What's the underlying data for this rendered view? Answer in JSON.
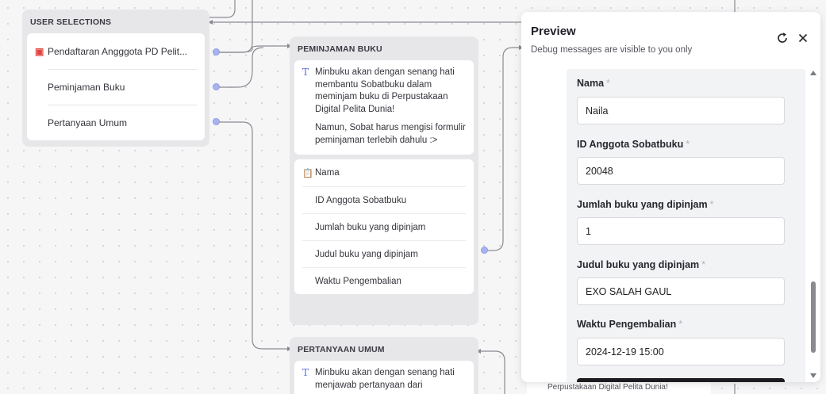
{
  "user_selections": {
    "header": "USER SELECTIONS",
    "items": [
      {
        "label": "Pendaftaran Angggota PD Pelit...",
        "icon": "form-icon"
      },
      {
        "label": "Peminjaman Buku"
      },
      {
        "label": "Pertanyaan Umum"
      }
    ]
  },
  "peminjaman": {
    "header": "PEMINJAMAN BUKU",
    "messages": [
      "Minbuku akan dengan senang hati membantu Sobatbuku dalam meminjam buku di Perpustakaan Digital Pelita Dunia!",
      "Namun, Sobat harus mengisi formulir peminjaman terlebih dahulu :>"
    ],
    "fields": [
      "Nama",
      "ID Anggota Sobatbuku",
      "Jumlah buku yang dipinjam",
      "Judul buku yang dipinjam",
      "Waktu Pengembalian"
    ]
  },
  "pertanyaan": {
    "header": "PERTANYAAN UMUM",
    "message": "Minbuku akan dengan senang hati menjawab pertanyaan dari"
  },
  "preview": {
    "title": "Preview",
    "subtitle": "Debug messages are visible to you only",
    "required_mark": "*",
    "form": [
      {
        "label": "Nama",
        "value": "Naila"
      },
      {
        "label": "ID Anggota Sobatbuku",
        "value": "20048"
      },
      {
        "label": "Jumlah buku yang dipinjam",
        "value": "1"
      },
      {
        "label": "Judul buku yang dipinjam",
        "value": "EXO SALAH GAUL"
      },
      {
        "label": "Waktu Pengembalian",
        "value": "2024-12-19 15:00"
      }
    ],
    "peek_text": "Perpustakaan Digital Pelita Dunia!"
  },
  "colors": {
    "accent": "#8d9be8",
    "form_icon": "#e0443c",
    "text_icon": "#5a6de0"
  }
}
